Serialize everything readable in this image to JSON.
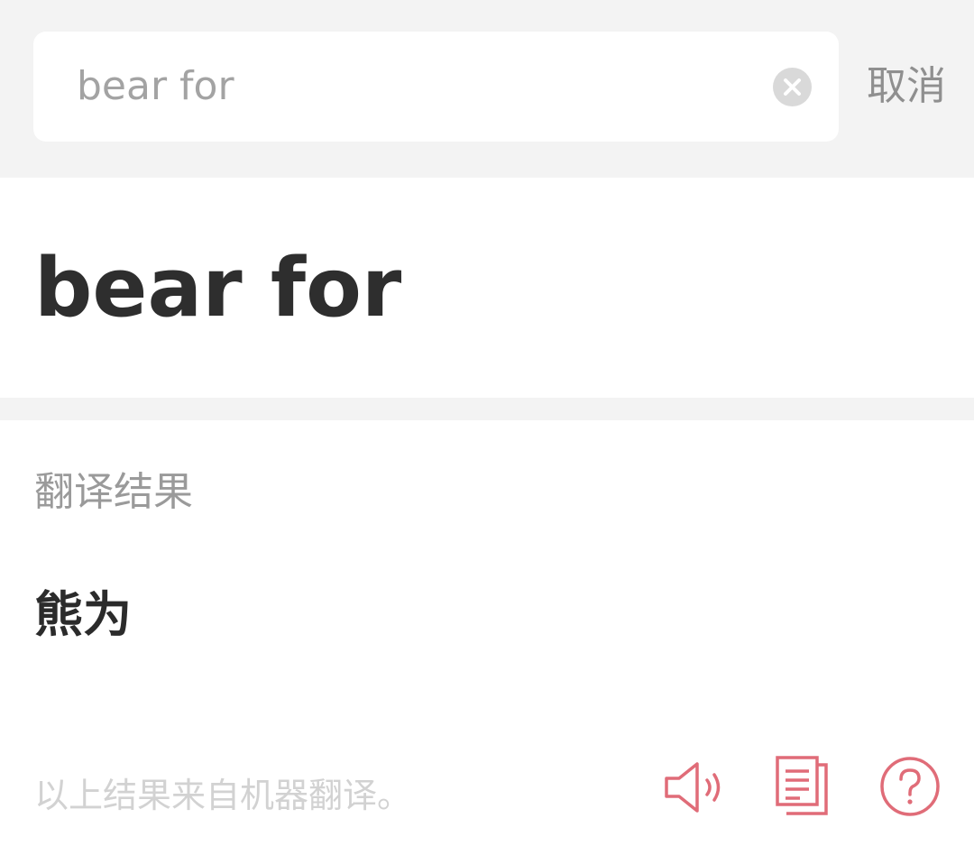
{
  "search": {
    "query": "bear for",
    "clear_icon": "clear-icon",
    "cancel_label": "取消"
  },
  "entry": {
    "headword": "bear for"
  },
  "result": {
    "section_label": "翻译结果",
    "translation": "熊为",
    "disclaimer": "以上结果来自机器翻译。",
    "actions": [
      {
        "icon": "speaker-icon"
      },
      {
        "icon": "copy-icon"
      },
      {
        "icon": "help-icon"
      }
    ]
  },
  "colors": {
    "accent": "#e06c78",
    "background_gray": "#f3f3f3",
    "clear_icon_gray": "#d9d9d9"
  }
}
